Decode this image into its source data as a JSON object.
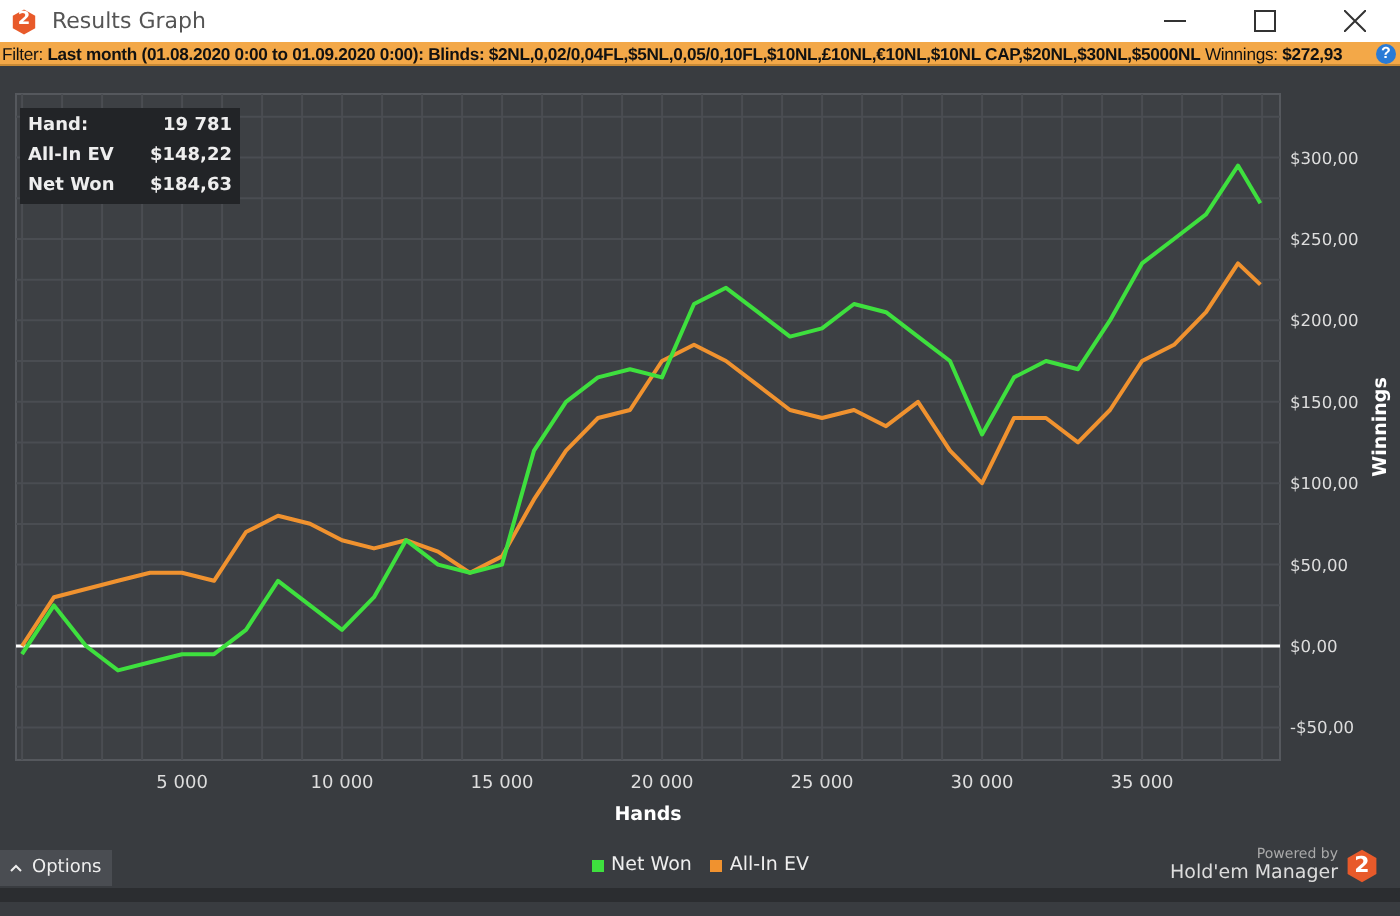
{
  "window": {
    "title": "Results Graph",
    "icon_mark": "2"
  },
  "filter_bar": {
    "text": "Filter: **Last month (01.08.2020 0:00 to 01.09.2020 0:00): Blinds: $2NL,0,02/0,04FL,$5NL,0,05/0,10FL,$10NL,£10NL,€10NL,$10NL CAP,$20NL,$30NL,$5000NL** Winnings: **$272,93**",
    "help_glyph": "?"
  },
  "stats": [
    {
      "label": "Hand:",
      "value": "19 781"
    },
    {
      "label": "All-In EV",
      "value": "$148,22"
    },
    {
      "label": "Net Won",
      "value": "$184,63"
    }
  ],
  "chart": {
    "chart_data": {
      "type": "line",
      "grid": true,
      "xlabel": "Hands",
      "ylabel": "Winnings",
      "x": [
        0,
        1000,
        2000,
        3000,
        4000,
        5000,
        6000,
        7000,
        8000,
        9000,
        10000,
        11000,
        12000,
        13000,
        14000,
        15000,
        16000,
        17000,
        18000,
        19000,
        20000,
        21000,
        22000,
        23000,
        24000,
        25000,
        26000,
        27000,
        28000,
        29000,
        30000,
        31000,
        32000,
        33000,
        34000,
        35000,
        36000,
        37000,
        38000,
        38700
      ],
      "series": [
        {
          "name": "Net Won",
          "color": "#3ee03e",
          "values": [
            -5,
            25,
            0,
            -15,
            -10,
            -5,
            -5,
            10,
            40,
            25,
            10,
            30,
            65,
            50,
            45,
            50,
            120,
            150,
            165,
            170,
            165,
            210,
            220,
            205,
            190,
            195,
            210,
            205,
            190,
            175,
            130,
            165,
            175,
            170,
            200,
            235,
            250,
            265,
            295,
            272
          ]
        },
        {
          "name": "All-In EV",
          "color": "#f0922f",
          "values": [
            0,
            30,
            35,
            40,
            45,
            45,
            40,
            70,
            80,
            75,
            65,
            60,
            65,
            58,
            45,
            55,
            90,
            120,
            140,
            145,
            175,
            185,
            175,
            160,
            145,
            140,
            145,
            135,
            150,
            120,
            100,
            140,
            140,
            125,
            145,
            175,
            185,
            205,
            235,
            222
          ]
        }
      ],
      "xlim": [
        -190,
        39310
      ],
      "ylim": [
        -70,
        339
      ],
      "xticks": [
        {
          "value": 5000,
          "label": "5 000"
        },
        {
          "value": 10000,
          "label": "10 000"
        },
        {
          "value": 15000,
          "label": "15 000"
        },
        {
          "value": 20000,
          "label": "20 000"
        },
        {
          "value": 25000,
          "label": "25 000"
        },
        {
          "value": 30000,
          "label": "30 000"
        },
        {
          "value": 35000,
          "label": "35 000"
        }
      ],
      "yticks": [
        {
          "value": -50,
          "label": "-$50,00"
        },
        {
          "value": 0,
          "label": "$0,00"
        },
        {
          "value": 50,
          "label": "$50,00"
        },
        {
          "value": 100,
          "label": "$100,00"
        },
        {
          "value": 150,
          "label": "$150,00"
        },
        {
          "value": 200,
          "label": "$200,00"
        },
        {
          "value": 250,
          "label": "$250,00"
        },
        {
          "value": 300,
          "label": "$300,00"
        }
      ]
    }
  },
  "options_button": {
    "label": "Options"
  },
  "branding": {
    "powered_by": "Powered by",
    "product": "Hold'em Manager",
    "logo_mark": "2"
  }
}
